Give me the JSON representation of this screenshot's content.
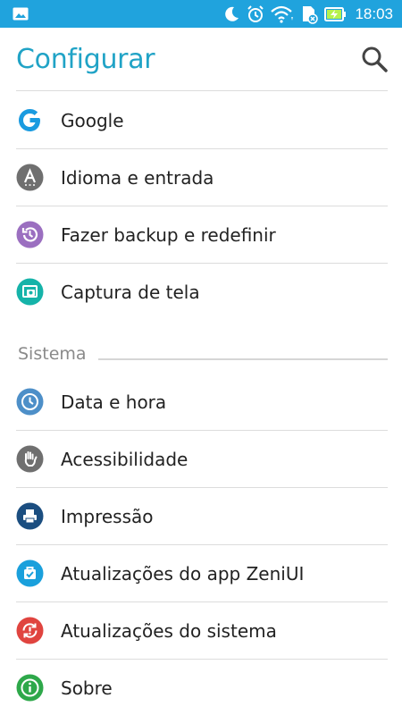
{
  "status_bar": {
    "time": "18:03",
    "icons": [
      "image-icon",
      "moon-icon",
      "alarm-icon",
      "wifi-icon",
      "sd-card-icon",
      "battery-charging-icon"
    ]
  },
  "header": {
    "title": "Configurar",
    "search_icon": "search-icon"
  },
  "colors": {
    "status_bar": "#20a3dd",
    "title": "#20a3c6",
    "google": "#1a9be0",
    "idioma": "#6f6f6f",
    "backup": "#9b6fc0",
    "captura": "#15b3a9",
    "data": "#4d8fc8",
    "acess": "#6f6f6f",
    "impressao": "#1b4e80",
    "zenui": "#1aa0dc",
    "sistema": "#e0443f",
    "sobre": "#2ea84a"
  },
  "items_top": [
    {
      "label": "Google",
      "icon": "google-icon"
    },
    {
      "label": "Idioma e entrada",
      "icon": "language-icon"
    },
    {
      "label": "Fazer backup e redefinir",
      "icon": "backup-icon"
    },
    {
      "label": "Captura de tela",
      "icon": "screenshot-icon"
    }
  ],
  "section_system": {
    "title": "Sistema",
    "items": [
      {
        "label": "Data e hora",
        "icon": "clock-icon"
      },
      {
        "label": "Acessibilidade",
        "icon": "hand-icon"
      },
      {
        "label": "Impressão",
        "icon": "printer-icon"
      },
      {
        "label": "Atualizações do app ZeniUI",
        "icon": "app-update-icon"
      },
      {
        "label": "Atualizações do sistema",
        "icon": "system-update-icon"
      },
      {
        "label": "Sobre",
        "icon": "info-icon"
      }
    ]
  }
}
